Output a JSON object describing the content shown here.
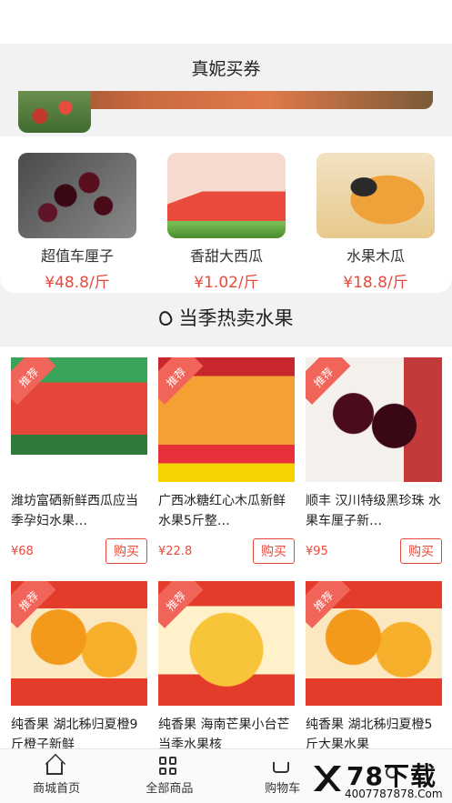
{
  "header": {
    "title": "真妮买券"
  },
  "featured": [
    {
      "name": "超值车厘子",
      "price": "¥48.8/斤",
      "image": "cherry"
    },
    {
      "name": "香甜大西瓜",
      "price": "¥1.02/斤",
      "image": "watermelon"
    },
    {
      "name": "水果木瓜",
      "price": "¥18.8/斤",
      "image": "papaya"
    }
  ],
  "section": {
    "title": "当季热卖水果",
    "icon": "fire-icon"
  },
  "products": [
    {
      "badge": "推荐",
      "title": "潍坊富硒新鲜西瓜应当季孕妇水果…",
      "price": "¥68",
      "button": "购买",
      "image": "watermelon"
    },
    {
      "badge": "推荐",
      "title": "广西冰糖红心木瓜新鲜水果5斤整…",
      "price": "¥22.8",
      "button": "购买",
      "image": "papaya"
    },
    {
      "badge": "推荐",
      "title": "顺丰 汉川特级黑珍珠 水果车厘子新…",
      "price": "¥95",
      "button": "购买",
      "image": "cherry"
    },
    {
      "badge": "推荐",
      "title": "纯香果 湖北秭归夏橙9斤橙子新鲜",
      "price": "",
      "button": "",
      "image": "orange"
    },
    {
      "badge": "推荐",
      "title": "纯香果 海南芒果小台芒当季水果核",
      "price": "",
      "button": "",
      "image": "mango"
    },
    {
      "badge": "推荐",
      "title": "纯香果 湖北秭归夏橙5斤大果水果",
      "price": "",
      "button": "",
      "image": "orange"
    }
  ],
  "tabbar": [
    {
      "label": "商城首页",
      "icon": "home-icon"
    },
    {
      "label": "全部商品",
      "icon": "grid-icon"
    },
    {
      "label": "购物车",
      "icon": "cart-icon"
    },
    {
      "label": "",
      "icon": "user-icon"
    }
  ],
  "watermark": {
    "main": "78下载",
    "url": "4007787878.Com"
  },
  "colors": {
    "price": "#e84a3b",
    "badge": "#f0645a"
  }
}
